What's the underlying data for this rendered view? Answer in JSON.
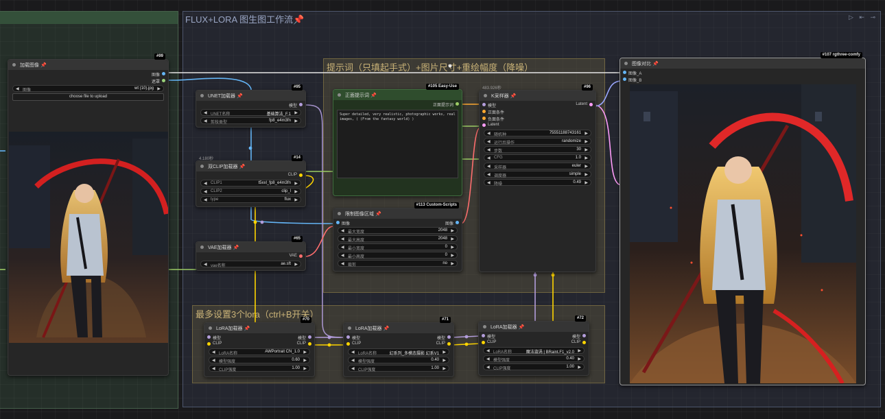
{
  "groups": {
    "main_title": "FLUX+LORA 图生图工作流📌",
    "prompt_title": "提示词（只填起手式）+图片尺寸+重绘幅度（降噪）",
    "lora_title": "最多设置3个lora（ctrl+B开关）",
    "left_marker": ")",
    "corner_icons": "▷ ⇤ ⊸"
  },
  "nodes": {
    "load_image": {
      "badge": "#99",
      "title": "加载图像",
      "out1": "图像",
      "out2": "遮罩",
      "image_label": "图像",
      "image_value": "wt (10).jpg",
      "upload_label": "choose file to upload"
    },
    "unet": {
      "badge": "#95",
      "title": "UNET加载器",
      "out": "模型",
      "w1_label": "UNET名称",
      "w1_value": "基础算法_F.1",
      "w2_label": "剪枝类型",
      "w2_value": "fp8_e4m3fn"
    },
    "dual_clip": {
      "badge": "#14",
      "time": "4.180秒",
      "title": "双CLIP加载器",
      "out": "CLIP",
      "w1_label": "CLIP1",
      "w1_value": "t5xxl_fp8_e4m3fn",
      "w2_label": "CLIP2",
      "w2_value": "clip_l",
      "w3_label": "type",
      "w3_value": "flux"
    },
    "vae": {
      "badge": "#65",
      "title": "VAE加载器",
      "out": "VAE",
      "w1_label": "vae名称",
      "w1_value": "ae.sft"
    },
    "positive": {
      "badge": "#105 Easy-Use",
      "title": "正面提示词",
      "out": "正面提示词",
      "text": "Super detailed, very realistic, photographic works, real images, ( (From the fantasy world) )"
    },
    "constrain": {
      "badge": "#113 Custom-Scripts",
      "title": "限制图像区域",
      "in": "图像",
      "out": "图像",
      "w1_label": "最大宽度",
      "w1_value": "2048",
      "w2_label": "最大高度",
      "w2_value": "2048",
      "w3_label": "最小宽度",
      "w3_value": "0",
      "w4_label": "最小高度",
      "w4_value": "0",
      "w5_label": "裁剪",
      "w5_value": "no"
    },
    "ksampler": {
      "badge": "#96",
      "time": "483.926秒",
      "title": "K采样器",
      "in1": "模型",
      "in2": "正面条件",
      "in3": "负面条件",
      "in4": "Latent",
      "out": "Latent",
      "w1_label": "随机种",
      "w1_value": "755511887431​61",
      "w2_label": "运行后操作",
      "w2_value": "randomize",
      "w3_label": "步数",
      "w3_value": "30",
      "w4_label": "CFG",
      "w4_value": "1.0",
      "w5_label": "采样器",
      "w5_value": "euler",
      "w6_label": "调度器",
      "w6_value": "simple",
      "w7_label": "降噪",
      "w7_value": "0.49"
    },
    "compare": {
      "badge": "#107 rgthree-comfy",
      "title": "图像对比",
      "in1": "图像_A",
      "in2": "图像_B"
    },
    "lora1": {
      "badge": "#70",
      "title": "LoRA加载器",
      "in1": "模型",
      "in2": "CLIP",
      "out1": "模型",
      "out2": "CLIP",
      "w1_label": "LoRA名称",
      "w1_value": "AWPortrait CN_1.0",
      "w2_label": "模型强度",
      "w2_value": "0.60",
      "w3_label": "CLIP强度",
      "w3_value": "1.00"
    },
    "lora2": {
      "badge": "#71",
      "title": "LoRA加载器",
      "in1": "模型",
      "in2": "CLIP",
      "out1": "模型",
      "out2": "CLIP",
      "w1_label": "LoRA名称",
      "w1_value": "幻系列_多模态摄影 幻系V1",
      "w2_label": "模型强度",
      "w2_value": "0.40",
      "w3_label": "CLIP强度",
      "w3_value": "1.00"
    },
    "lora3": {
      "badge": "#72",
      "title": "LoRA加载器",
      "in1": "模型",
      "in2": "CLIP",
      "out1": "模型",
      "out2": "CLIP",
      "w1_label": "LoRA名称",
      "w1_value": "魔法漩涡 | BRaint.F1_v2.0",
      "w2_label": "模型强度",
      "w2_value": "0.40",
      "w3_label": "CLIP强度",
      "w3_value": "1.00"
    }
  },
  "colors": {
    "model_wire": "#b39ddb",
    "clip_wire": "#ffd500",
    "vae_wire": "#ff6e6e",
    "image_wire": "#64b5f6",
    "latent_wire": "#ff9cf9",
    "cond_wire": "#ffa931",
    "text_wire": "#9ccc65"
  }
}
